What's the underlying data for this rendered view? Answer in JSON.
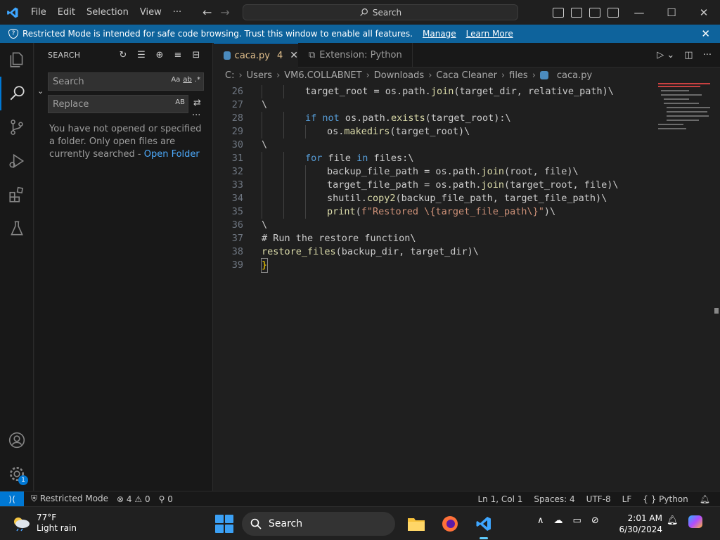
{
  "titlebar": {
    "menu": [
      "File",
      "Edit",
      "Selection",
      "View",
      "···"
    ],
    "search": "Search"
  },
  "banner": {
    "message": "Restricted Mode is intended for safe code browsing. Trust this window to enable all features.",
    "manage": "Manage",
    "learn_more": "Learn More"
  },
  "sidebar": {
    "title": "SEARCH",
    "search_placeholder": "Search",
    "replace_placeholder": "Replace",
    "opt_case": "Aa",
    "opt_word": "ab",
    "opt_regex": ".*",
    "opt_preserve": "AB",
    "message": "You have not opened or specified a folder. Only open files are currently searched - ",
    "open_folder": "Open Folder"
  },
  "tabs": [
    {
      "label": "caca.py",
      "count": "4"
    },
    {
      "label": "Extension: Python"
    }
  ],
  "breadcrumb": [
    "C:",
    "Users",
    "VM6.COLLABNET",
    "Downloads",
    "Caca Cleaner",
    "files",
    "caca.py"
  ],
  "code_lines": [
    {
      "num": "26",
      "indent": 2,
      "html_tokens": [
        [
          "",
          "target_root = os.path."
        ],
        [
          "fn",
          "join"
        ],
        [
          "",
          "(target_dir, relative_path)\\"
        ]
      ]
    },
    {
      "num": "27",
      "indent": 0,
      "html_tokens": [
        [
          "",
          "\\"
        ]
      ]
    },
    {
      "num": "28",
      "indent": 2,
      "html_tokens": [
        [
          "kw",
          "if not "
        ],
        [
          "",
          "os.path."
        ],
        [
          "fn",
          "exists"
        ],
        [
          "",
          "(target_root):\\"
        ]
      ]
    },
    {
      "num": "29",
      "indent": 3,
      "html_tokens": [
        [
          "",
          "os."
        ],
        [
          "fn",
          "makedirs"
        ],
        [
          "",
          "(target_root)\\"
        ]
      ]
    },
    {
      "num": "30",
      "indent": 0,
      "html_tokens": [
        [
          "",
          "\\"
        ]
      ]
    },
    {
      "num": "31",
      "indent": 2,
      "html_tokens": [
        [
          "kw",
          "for "
        ],
        [
          "",
          "file "
        ],
        [
          "kw",
          "in "
        ],
        [
          "",
          "files:\\"
        ]
      ]
    },
    {
      "num": "32",
      "indent": 3,
      "html_tokens": [
        [
          "",
          "backup_file_path = os.path."
        ],
        [
          "fn",
          "join"
        ],
        [
          "",
          "(root, file)\\"
        ]
      ]
    },
    {
      "num": "33",
      "indent": 3,
      "html_tokens": [
        [
          "",
          "target_file_path = os.path."
        ],
        [
          "fn",
          "join"
        ],
        [
          "",
          "(target_root, file)\\"
        ]
      ]
    },
    {
      "num": "34",
      "indent": 3,
      "html_tokens": [
        [
          "",
          "shutil."
        ],
        [
          "fn",
          "copy2"
        ],
        [
          "",
          "(backup_file_path, target_file_path)\\"
        ]
      ]
    },
    {
      "num": "35",
      "indent": 3,
      "html_tokens": [
        [
          "fn",
          "print"
        ],
        [
          "",
          "("
        ],
        [
          "str",
          "f\"Restored \\{target_file_path\\}\""
        ],
        [
          "",
          ")\\"
        ]
      ]
    },
    {
      "num": "36",
      "indent": 0,
      "html_tokens": [
        [
          "",
          "\\"
        ]
      ]
    },
    {
      "num": "37",
      "indent": 0,
      "html_tokens": [
        [
          "",
          "# Run the restore function\\"
        ]
      ]
    },
    {
      "num": "38",
      "indent": 0,
      "html_tokens": [
        [
          "fn",
          "restore_files"
        ],
        [
          "",
          "(backup_dir, target_dir)\\"
        ]
      ]
    },
    {
      "num": "39",
      "indent": 0,
      "html_tokens": [
        [
          "",
          "}"
        ]
      ]
    }
  ],
  "statusbar": {
    "restricted": "Restricted Mode",
    "errors": "4",
    "warnings": "0",
    "ports": "0",
    "position": "Ln 1, Col 1",
    "spaces": "Spaces: 4",
    "encoding": "UTF-8",
    "eol": "LF",
    "language": "Python"
  },
  "taskbar": {
    "temp": "77°F",
    "weather": "Light rain",
    "search": "Search",
    "time": "2:01 AM",
    "date": "6/30/2024"
  },
  "activity_badge": "1",
  "colors": {
    "accent": "#0078d4",
    "banner": "#0e639c",
    "modified_tab": "#e2c08d"
  }
}
